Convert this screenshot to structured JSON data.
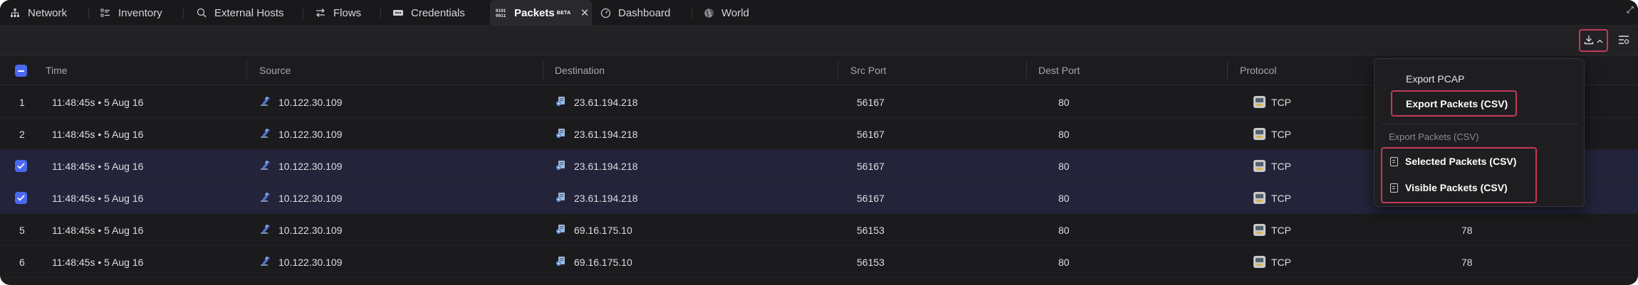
{
  "tabs": [
    {
      "label": "Network",
      "icon": "network-icon"
    },
    {
      "label": "Inventory",
      "icon": "inventory-icon"
    },
    {
      "label": "External Hosts",
      "icon": "external-hosts-icon"
    },
    {
      "label": "Flows",
      "icon": "flows-icon"
    },
    {
      "label": "Credentials",
      "icon": "credentials-icon"
    },
    {
      "label": "Packets",
      "badge": "BETA",
      "icon": "packets-icon",
      "active": true
    },
    {
      "label": "Dashboard",
      "icon": "dashboard-icon"
    },
    {
      "label": "World",
      "icon": "globe-icon"
    }
  ],
  "columns": [
    "Time",
    "Source",
    "Destination",
    "Src Port",
    "Dest Port",
    "Protocol"
  ],
  "rows": [
    {
      "num": "1",
      "time": "11:48:45s • 5 Aug 16",
      "source": "10.122.30.109",
      "destination": "23.61.194.218",
      "src_port": "56167",
      "dest_port": "80",
      "protocol": "TCP",
      "extra": "",
      "selected": false
    },
    {
      "num": "2",
      "time": "11:48:45s • 5 Aug 16",
      "source": "10.122.30.109",
      "destination": "23.61.194.218",
      "src_port": "56167",
      "dest_port": "80",
      "protocol": "TCP",
      "extra": "",
      "selected": false
    },
    {
      "num": "",
      "time": "11:48:45s • 5 Aug 16",
      "source": "10.122.30.109",
      "destination": "23.61.194.218",
      "src_port": "56167",
      "dest_port": "80",
      "protocol": "TCP",
      "extra": "",
      "selected": true
    },
    {
      "num": "",
      "time": "11:48:45s • 5 Aug 16",
      "source": "10.122.30.109",
      "destination": "23.61.194.218",
      "src_port": "56167",
      "dest_port": "80",
      "protocol": "TCP",
      "extra": "",
      "selected": true
    },
    {
      "num": "5",
      "time": "11:48:45s • 5 Aug 16",
      "source": "10.122.30.109",
      "destination": "69.16.175.10",
      "src_port": "56153",
      "dest_port": "80",
      "protocol": "TCP",
      "extra": "78",
      "selected": false
    },
    {
      "num": "6",
      "time": "11:48:45s • 5 Aug 16",
      "source": "10.122.30.109",
      "destination": "69.16.175.10",
      "src_port": "56153",
      "dest_port": "80",
      "protocol": "TCP",
      "extra": "78",
      "selected": false
    }
  ],
  "export_menu": {
    "pcap": "Export PCAP",
    "packets_csv": "Export Packets (CSV)",
    "section_title": "Export Packets (CSV)",
    "selected_csv": "Selected Packets (CSV)",
    "visible_csv": "Visible Packets (CSV)"
  },
  "colors": {
    "accent": "#4b68f0",
    "highlight": "#c23a55",
    "selected_row": "#23243a"
  }
}
